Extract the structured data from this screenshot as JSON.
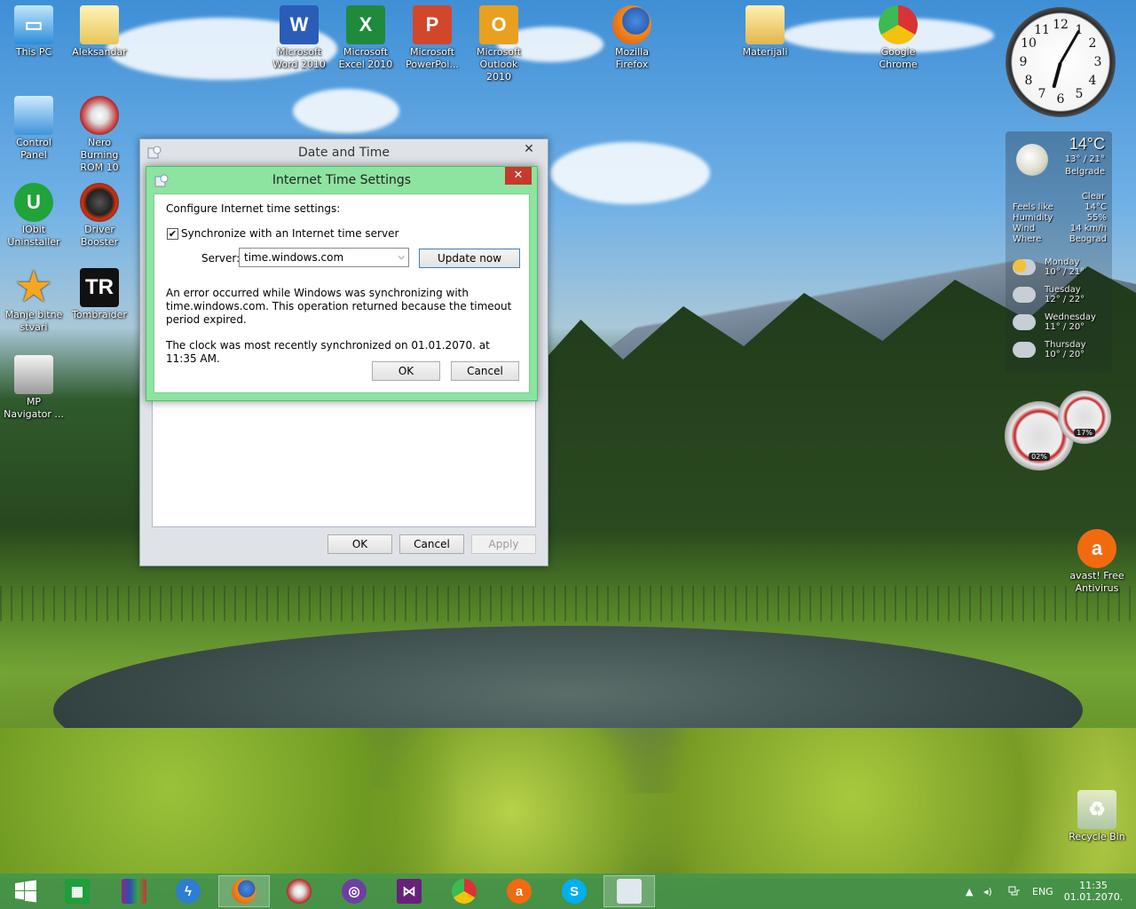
{
  "desktop": {
    "icons": [
      {
        "label": "This PC"
      },
      {
        "label": "Aleksandar"
      },
      {
        "label": "Microsoft Word 2010"
      },
      {
        "label": "Microsoft Excel 2010"
      },
      {
        "label": "Microsoft PowerPoi..."
      },
      {
        "label": "Microsoft Outlook 2010"
      },
      {
        "label": "Mozilla Firefox"
      },
      {
        "label": "Materijali"
      },
      {
        "label": "Google Chrome"
      },
      {
        "label": "Control Panel"
      },
      {
        "label": "Nero Burning ROM 10"
      },
      {
        "label": "IObit Uninstaller"
      },
      {
        "label": "Driver Booster"
      },
      {
        "label": "Manje bitne stvari"
      },
      {
        "label": "Tombraider"
      },
      {
        "label": "MP Navigator ..."
      },
      {
        "label": "avast! Free Antivirus"
      },
      {
        "label": "Recycle Bin"
      }
    ],
    "tombraider_glyph": "TR"
  },
  "clock_gadget": {
    "numerals": [
      "12",
      "1",
      "2",
      "3",
      "4",
      "5",
      "6",
      "7",
      "8",
      "9",
      "10",
      "11"
    ]
  },
  "weather_gadget": {
    "temperature": "14°C",
    "range": "13° / 21°",
    "city": "Belgrade",
    "condition": "Clear",
    "details": [
      {
        "label": "Feels like",
        "value": "14°C"
      },
      {
        "label": "Humidity",
        "value": "55%"
      },
      {
        "label": "Wind",
        "value": "14 km/h"
      },
      {
        "label": "Where",
        "value": "Beograd"
      }
    ],
    "forecast": [
      {
        "day": "Monday",
        "temps": "10° / 21°"
      },
      {
        "day": "Tuesday",
        "temps": "12° / 22°"
      },
      {
        "day": "Wednesday",
        "temps": "11° / 20°"
      },
      {
        "day": "Thursday",
        "temps": "10° / 20°"
      }
    ]
  },
  "cpu_meter": {
    "cpu": "02%",
    "memory": "17%"
  },
  "date_time_window": {
    "title": "Date and Time",
    "close_glyph": "✕",
    "ok": "OK",
    "cancel": "Cancel",
    "apply": "Apply"
  },
  "internet_time_dialog": {
    "title": "Internet Time Settings",
    "close_glyph": "✕",
    "heading": "Configure Internet time settings:",
    "sync_label": "Synchronize with an Internet time server",
    "sync_checked": true,
    "check_glyph": "✔",
    "server_label": "Server:",
    "server_value": "time.windows.com",
    "update_now": "Update now",
    "error_message": "An error occurred while Windows was synchronizing with time.windows.com.  This operation returned because the timeout period expired.",
    "last_sync": "The clock was most recently synchronized on 01.01.2070. at 11:35 AM.",
    "ok": "OK",
    "cancel": "Cancel"
  },
  "taskbar": {
    "apps": [
      "start-icon",
      "store-icon",
      "winrar-icon",
      "thunder-icon",
      "firefox-icon",
      "nero-icon",
      "torrent-icon",
      "visual-studio-icon",
      "chrome-icon",
      "avast-icon",
      "skype-icon",
      "date-time-icon"
    ],
    "skype_glyph": "S",
    "tray": {
      "language": "ENG",
      "time": "11:35",
      "date": "01.01.2070.",
      "chevron": "▲",
      "volume": "◂)"
    }
  }
}
